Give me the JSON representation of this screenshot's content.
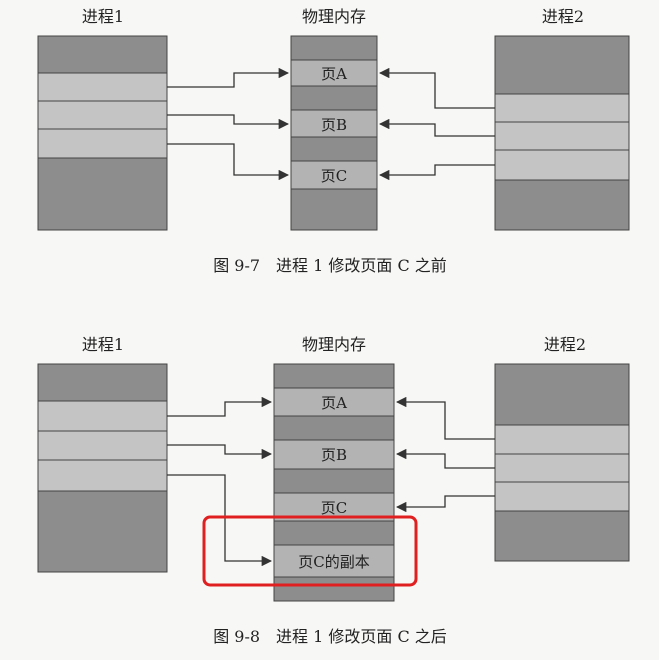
{
  "colors": {
    "background": "#f7f7f5",
    "block_dark": "#8d8d8d",
    "block_light": "#c4c4c4",
    "page_cell": "#b3b3b3",
    "highlight": "#e02020"
  },
  "diagram1": {
    "process1_label": "进程1",
    "memory_label": "物理内存",
    "process2_label": "进程2",
    "pages": [
      "页A",
      "页B",
      "页C"
    ],
    "caption": "图 9-7　进程 1 修改页面 C 之前"
  },
  "diagram2": {
    "process1_label": "进程1",
    "memory_label": "物理内存",
    "process2_label": "进程2",
    "pages": [
      "页A",
      "页B",
      "页C",
      "页C的副本"
    ],
    "caption": "图 9-8　进程 1 修改页面 C 之后"
  }
}
